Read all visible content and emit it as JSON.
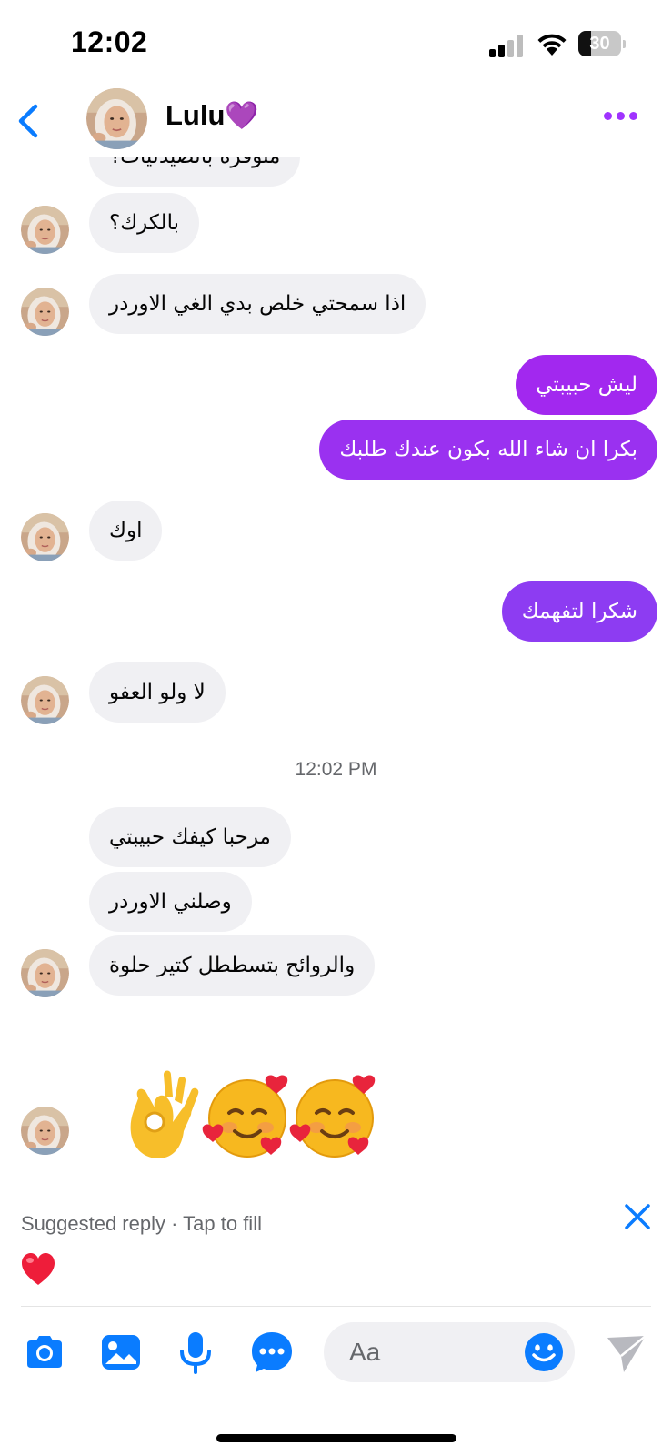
{
  "status_bar": {
    "time": "12:02",
    "battery": "30",
    "battery_level": 0.3
  },
  "header": {
    "contact_name": "Lulu",
    "contact_emoji": "💜"
  },
  "messages": [
    {
      "dir": "in",
      "text": "متوفرة بالصيدليات؟"
    },
    {
      "dir": "in",
      "text": "بالكرك؟"
    },
    {
      "dir": "in",
      "text": "اذا سمحتي خلص بدي الغي الاوردر"
    },
    {
      "dir": "out",
      "text": "ليش حبيبتي"
    },
    {
      "dir": "out",
      "text": "بكرا ان شاء الله بكون عندك طلبك"
    },
    {
      "dir": "in",
      "text": "اوك"
    },
    {
      "dir": "out",
      "text": "شكرا لتفهمك"
    },
    {
      "dir": "in",
      "text": "لا ولو العفو"
    },
    {
      "dir": "in",
      "text": "مرحبا كيفك حبيبتي"
    },
    {
      "dir": "in",
      "text": "وصلني الاوردر"
    },
    {
      "dir": "in",
      "text": "والروائح بتسططل كتير حلوة"
    }
  ],
  "timestamp": "12:02 PM",
  "emoji_message": [
    "ok-hand",
    "smiling-face-with-hearts",
    "smiling-face-with-hearts"
  ],
  "suggested_reply": {
    "label": "Suggested reply · Tap to fill",
    "reply": "❤️"
  },
  "composer": {
    "placeholder": "Aa"
  },
  "colors": {
    "accent": "#a033ff",
    "outgoing_top": "#a228ef",
    "outgoing_bottom": "#8d3cf2",
    "incoming": "#f0f0f3",
    "icon_blue": "#0a7cff"
  },
  "icons": {
    "back": "chevron-left-icon",
    "more": "more-dots-icon",
    "close": "close-icon",
    "camera": "camera-icon",
    "gallery": "gallery-icon",
    "mic": "microphone-icon",
    "apps": "chat-apps-icon",
    "smile": "smile-icon",
    "send": "send-icon"
  }
}
